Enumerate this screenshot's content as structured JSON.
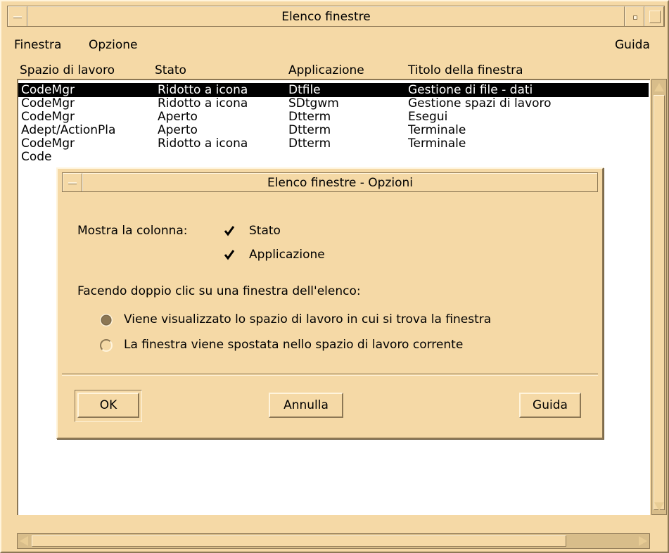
{
  "window": {
    "title": "Elenco finestre"
  },
  "menubar": {
    "finestra": "Finestra",
    "opzione": "Opzione",
    "guida": "Guida"
  },
  "columns": {
    "workspace": "Spazio di lavoro",
    "state": "Stato",
    "application": "Applicazione",
    "title": "Titolo della finestra"
  },
  "rows": [
    {
      "workspace": "CodeMgr",
      "state": "Ridotto a icona",
      "application": "Dtfile",
      "title": "Gestione di file - dati",
      "selected": true
    },
    {
      "workspace": "CodeMgr",
      "state": "Ridotto a icona",
      "application": "SDtgwm",
      "title": "Gestione spazi di lavoro",
      "selected": false
    },
    {
      "workspace": "CodeMgr",
      "state": "Aperto",
      "application": "Dtterm",
      "title": "Esegui",
      "selected": false
    },
    {
      "workspace": "Adept/ActionPla",
      "state": "Aperto",
      "application": "Dtterm",
      "title": "Terminale",
      "selected": false
    },
    {
      "workspace": "CodeMgr",
      "state": "Ridotto a icona",
      "application": "Dtterm",
      "title": "Terminale",
      "selected": false
    },
    {
      "workspace": "Code",
      "state": "",
      "application": "",
      "title": "",
      "selected": false
    }
  ],
  "dialog": {
    "title": "Elenco finestre - Opzioni",
    "show_column_label": "Mostra la colonna:",
    "checkbox_state": {
      "label": "Stato",
      "checked": true
    },
    "checkbox_application": {
      "label": "Applicazione",
      "checked": true
    },
    "double_click_label": "Facendo doppio clic su una finestra dell'elenco:",
    "radio_show_workspace": {
      "label": "Viene visualizzato lo spazio di lavoro in cui si trova la finestra",
      "selected": true
    },
    "radio_move_window": {
      "label": "La finestra viene spostata nello spazio di lavoro corrente",
      "selected": false
    },
    "ok_label": "OK",
    "cancel_label": "Annulla",
    "help_label": "Guida"
  },
  "colors": {
    "background": "#f5d9a6",
    "highlight": "#fff4dc",
    "shadow": "#8c7754",
    "list_bg": "#ffffff",
    "selection_bg": "#000000",
    "selection_fg": "#ffffff"
  },
  "icons": {
    "window_menu": "window-menu-icon",
    "minimize": "minimize-icon",
    "maximize": "maximize-icon",
    "check": "check-icon"
  }
}
